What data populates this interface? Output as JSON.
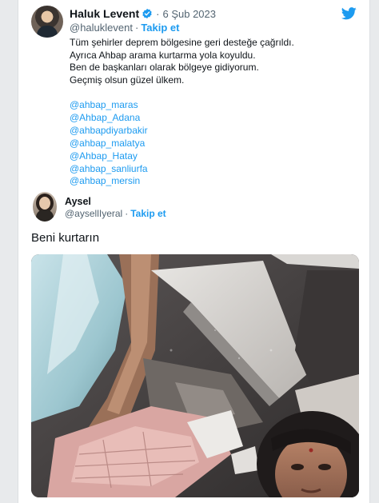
{
  "tweet": {
    "author_name": "Haluk Levent",
    "separator": "·",
    "date": "6 Şub 2023",
    "handle": "@haluklevent",
    "handle_separator": "·",
    "follow_label": "Takip et",
    "text_lines": [
      "Tüm şehirler deprem bölgesine geri desteğe çağrıldı.",
      "Ayrıca Ahbap arama kurtarma yola koyuldu.",
      "Ben de başkanları olarak bölgeye gidiyorum.",
      "Geçmiş olsun güzel ülkem."
    ],
    "mentions": [
      "@ahbap_maras",
      "@Ahbap_Adana",
      "@ahbapdiyarbakir",
      "@ahbap_malatya",
      "@Ahbap_Hatay",
      "@ahbap_sanliurfa",
      "@ahbap_mersin"
    ]
  },
  "quoted_tweet": {
    "author_name": "Aysel",
    "handle": "@aysellIyeral",
    "handle_separator": "·",
    "follow_label": "Takip et",
    "text": "Beni kurtarın"
  },
  "icons": {
    "verified": "verified-badge-icon",
    "brand": "twitter-bird-icon"
  },
  "colors": {
    "link": "#1d9bf0",
    "text": "#0f1419",
    "secondary_text": "#536471",
    "background": "#ffffff"
  }
}
